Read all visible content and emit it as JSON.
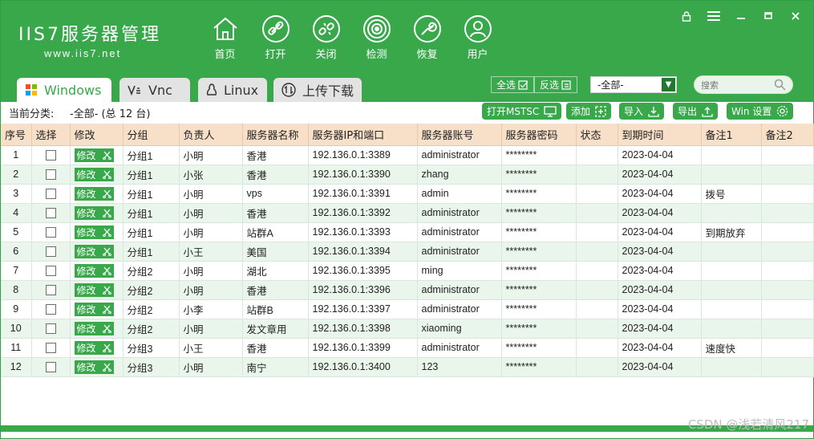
{
  "app": {
    "logo_title": "IIS7服务器管理",
    "logo_url": "www.iis7.net"
  },
  "toolbar": [
    {
      "label": "首页",
      "icon": "home-icon"
    },
    {
      "label": "打开",
      "icon": "link-icon"
    },
    {
      "label": "关闭",
      "icon": "unlink-icon"
    },
    {
      "label": "检测",
      "icon": "radar-icon"
    },
    {
      "label": "恢复",
      "icon": "wrench-icon"
    },
    {
      "label": "用户",
      "icon": "user-icon"
    }
  ],
  "tabs": [
    {
      "label": "Windows",
      "icon": "windows-icon"
    },
    {
      "label": "Vnc",
      "icon": "vnc-icon"
    },
    {
      "label": "Linux",
      "icon": "linux-icon"
    },
    {
      "label": "上传下载",
      "icon": "transfer-icon"
    }
  ],
  "filter": {
    "select_all": "全选",
    "invert": "反选",
    "category_value": "-全部-",
    "search_placeholder": "搜索"
  },
  "status": {
    "category_label": "当前分类:",
    "category_value": "-全部- (总 12 台)"
  },
  "actions": {
    "mstsc": "打开MSTSC",
    "add": "添加",
    "import": "导入",
    "export": "导出",
    "win_settings": "Win 设置"
  },
  "table": {
    "headers": [
      "序号",
      "选择",
      "修改",
      "分组",
      "负责人",
      "服务器名称",
      "服务器IP和端口",
      "服务器账号",
      "服务器密码",
      "状态",
      "到期时间",
      "备注1",
      "备注2"
    ],
    "edit_label": "修改",
    "rows": [
      {
        "no": "1",
        "group": "分组1",
        "owner": "小明",
        "name": "香港",
        "ip": "192.136.0.1:3389",
        "account": "administrator",
        "password": "********",
        "status": "",
        "expire": "2023-04-04",
        "note1": "",
        "note2": ""
      },
      {
        "no": "2",
        "group": "分组1",
        "owner": "小张",
        "name": "香港",
        "ip": "192.136.0.1:3390",
        "account": "zhang",
        "password": "********",
        "status": "",
        "expire": "2023-04-04",
        "note1": "",
        "note2": ""
      },
      {
        "no": "3",
        "group": "分组1",
        "owner": "小明",
        "name": "vps",
        "ip": "192.136.0.1:3391",
        "account": "admin",
        "password": "********",
        "status": "",
        "expire": "2023-04-04",
        "note1": "拨号",
        "note2": ""
      },
      {
        "no": "4",
        "group": "分组1",
        "owner": "小明",
        "name": "香港",
        "ip": "192.136.0.1:3392",
        "account": "administrator",
        "password": "********",
        "status": "",
        "expire": "2023-04-04",
        "note1": "",
        "note2": ""
      },
      {
        "no": "5",
        "group": "分组1",
        "owner": "小明",
        "name": "站群A",
        "ip": "192.136.0.1:3393",
        "account": "administrator",
        "password": "********",
        "status": "",
        "expire": "2023-04-04",
        "note1": "到期放弃",
        "note2": ""
      },
      {
        "no": "6",
        "group": "分组1",
        "owner": "小王",
        "name": "美国",
        "ip": "192.136.0.1:3394",
        "account": "administrator",
        "password": "********",
        "status": "",
        "expire": "2023-04-04",
        "note1": "",
        "note2": ""
      },
      {
        "no": "7",
        "group": "分组2",
        "owner": "小明",
        "name": "湖北",
        "ip": "192.136.0.1:3395",
        "account": "ming",
        "password": "********",
        "status": "",
        "expire": "2023-04-04",
        "note1": "",
        "note2": ""
      },
      {
        "no": "8",
        "group": "分组2",
        "owner": "小明",
        "name": "香港",
        "ip": "192.136.0.1:3396",
        "account": "administrator",
        "password": "********",
        "status": "",
        "expire": "2023-04-04",
        "note1": "",
        "note2": ""
      },
      {
        "no": "9",
        "group": "分组2",
        "owner": "小李",
        "name": "站群B",
        "ip": "192.136.0.1:3397",
        "account": "administrator",
        "password": "********",
        "status": "",
        "expire": "2023-04-04",
        "note1": "",
        "note2": ""
      },
      {
        "no": "10",
        "group": "分组2",
        "owner": "小明",
        "name": "发文章用",
        "ip": "192.136.0.1:3398",
        "account": "xiaoming",
        "password": "********",
        "status": "",
        "expire": "2023-04-04",
        "note1": "",
        "note2": ""
      },
      {
        "no": "11",
        "group": "分组3",
        "owner": "小王",
        "name": "香港",
        "ip": "192.136.0.1:3399",
        "account": "administrator",
        "password": "********",
        "status": "",
        "expire": "2023-04-04",
        "note1": "速度快",
        "note2": ""
      },
      {
        "no": "12",
        "group": "分组3",
        "owner": "小明",
        "name": "南宁",
        "ip": "192.136.0.1:3400",
        "account": "123",
        "password": "********",
        "status": "",
        "expire": "2023-04-04",
        "note1": "",
        "note2": ""
      }
    ]
  },
  "watermark": "CSDN @浅若清风217",
  "colors": {
    "brand_green": "#38a84a",
    "header_row": "#f7dfc8",
    "alt_row": "#eaf5ec"
  }
}
